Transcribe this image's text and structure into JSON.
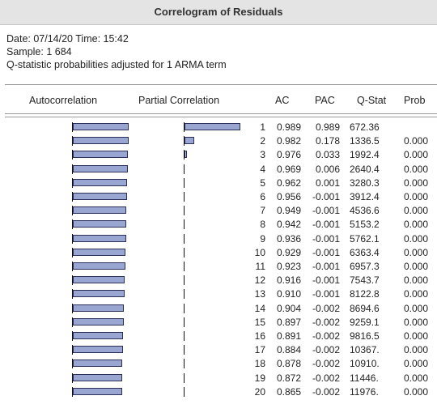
{
  "window": {
    "title": "Correlogram of Residuals"
  },
  "info": {
    "date_line": "Date: 07/14/20   Time: 15:42",
    "sample_line": "Sample: 1 684",
    "qstat_line": "Q-statistic probabilities adjusted for 1 ARMA term"
  },
  "headers": {
    "autocorrelation": "Autocorrelation",
    "partial_correlation": "Partial Correlation",
    "ac": "AC",
    "pac": "PAC",
    "qstat": "Q-Stat",
    "prob": "Prob"
  },
  "rows": [
    {
      "lag": "1",
      "ac": "0.989",
      "pac": "0.989",
      "qstat": "672.36",
      "prob": ""
    },
    {
      "lag": "2",
      "ac": "0.982",
      "pac": "0.178",
      "qstat": "1336.5",
      "prob": "0.000"
    },
    {
      "lag": "3",
      "ac": "0.976",
      "pac": "0.033",
      "qstat": "1992.4",
      "prob": "0.000"
    },
    {
      "lag": "4",
      "ac": "0.969",
      "pac": "0.006",
      "qstat": "2640.4",
      "prob": "0.000"
    },
    {
      "lag": "5",
      "ac": "0.962",
      "pac": "0.001",
      "qstat": "3280.3",
      "prob": "0.000"
    },
    {
      "lag": "6",
      "ac": "0.956",
      "pac": "-0.001",
      "qstat": "3912.4",
      "prob": "0.000"
    },
    {
      "lag": "7",
      "ac": "0.949",
      "pac": "-0.001",
      "qstat": "4536.6",
      "prob": "0.000"
    },
    {
      "lag": "8",
      "ac": "0.942",
      "pac": "-0.001",
      "qstat": "5153.2",
      "prob": "0.000"
    },
    {
      "lag": "9",
      "ac": "0.936",
      "pac": "-0.001",
      "qstat": "5762.1",
      "prob": "0.000"
    },
    {
      "lag": "10",
      "ac": "0.929",
      "pac": "-0.001",
      "qstat": "6363.4",
      "prob": "0.000"
    },
    {
      "lag": "11",
      "ac": "0.923",
      "pac": "-0.001",
      "qstat": "6957.3",
      "prob": "0.000"
    },
    {
      "lag": "12",
      "ac": "0.916",
      "pac": "-0.001",
      "qstat": "7543.7",
      "prob": "0.000"
    },
    {
      "lag": "13",
      "ac": "0.910",
      "pac": "-0.001",
      "qstat": "8122.8",
      "prob": "0.000"
    },
    {
      "lag": "14",
      "ac": "0.904",
      "pac": "-0.002",
      "qstat": "8694.6",
      "prob": "0.000"
    },
    {
      "lag": "15",
      "ac": "0.897",
      "pac": "-0.002",
      "qstat": "9259.1",
      "prob": "0.000"
    },
    {
      "lag": "16",
      "ac": "0.891",
      "pac": "-0.002",
      "qstat": "9816.5",
      "prob": "0.000"
    },
    {
      "lag": "17",
      "ac": "0.884",
      "pac": "-0.002",
      "qstat": "10367.",
      "prob": "0.000"
    },
    {
      "lag": "18",
      "ac": "0.878",
      "pac": "-0.002",
      "qstat": "10910.",
      "prob": "0.000"
    },
    {
      "lag": "19",
      "ac": "0.872",
      "pac": "-0.002",
      "qstat": "11446.",
      "prob": "0.000"
    },
    {
      "lag": "20",
      "ac": "0.865",
      "pac": "-0.002",
      "qstat": "11976.",
      "prob": "0.000"
    }
  ],
  "colors": {
    "bar_fill": "#9aa6d2",
    "bar_border": "#2b2f5a",
    "titlebar": "#e4e4e4"
  }
}
